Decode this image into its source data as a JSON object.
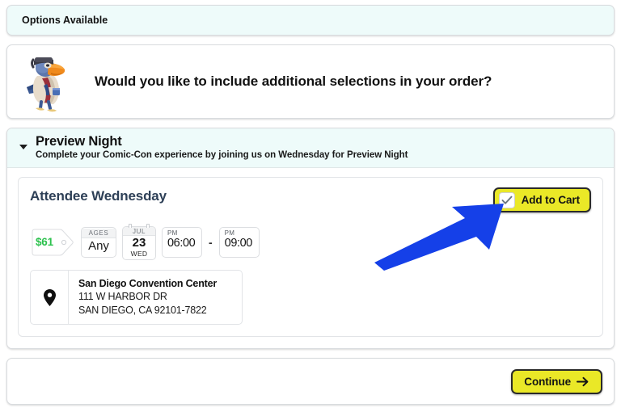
{
  "banner": {
    "title": "Options Available"
  },
  "intro": {
    "mascot_icon": "toucan-mascot-icon",
    "question": "Would you like to include additional selections in your order?"
  },
  "section": {
    "caret_icon": "chevron-down-icon",
    "title": "Preview Night",
    "subtitle": "Complete your Comic-Con experience by joining us on Wednesday for Preview Night"
  },
  "offer": {
    "title": "Attendee Wednesday",
    "add_to_cart": {
      "label": "Add to Cart",
      "checkbox_icon": "check-icon",
      "checked": true,
      "bg_color": "#eae827"
    },
    "price": {
      "icon": "price-tag-icon",
      "amount": "$61",
      "color": "#2dc14e"
    },
    "ages": {
      "header": "AGES",
      "value": "Any"
    },
    "date": {
      "icon": "calendar-icon",
      "month": "JUL",
      "day": "23",
      "weekday": "WED"
    },
    "time": {
      "start_meridiem": "PM",
      "start": "06:00",
      "separator": "-",
      "end_meridiem": "PM",
      "end": "09:00"
    },
    "venue": {
      "icon": "map-pin-icon",
      "name": "San Diego Convention Center",
      "address_line1": "111 W HARBOR DR",
      "address_line2": "SAN DIEGO, CA 92101-7822"
    }
  },
  "footer": {
    "continue_label": "Continue",
    "continue_arrow": "arrow-right-icon"
  },
  "annotation": {
    "arrow_icon": "pointer-arrow-icon",
    "color": "#1540e8"
  }
}
